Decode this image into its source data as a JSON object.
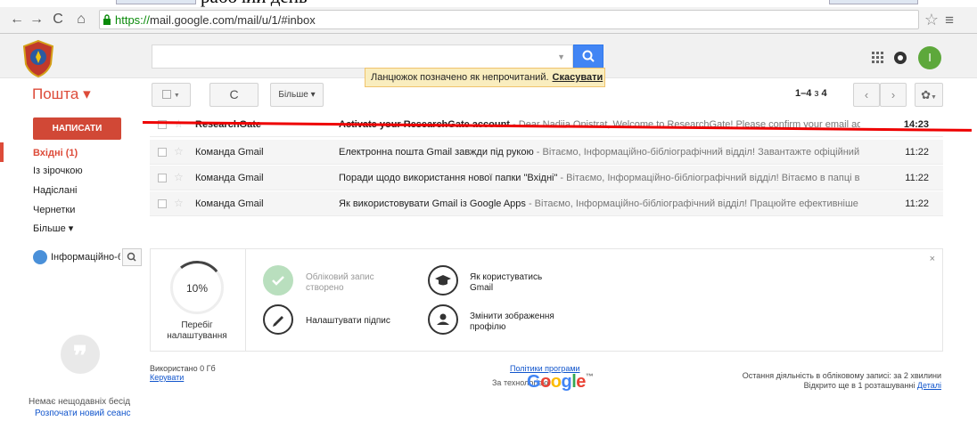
{
  "browser": {
    "cutoff_text": "рабочий день",
    "url_https": "https://",
    "url_rest": "mail.google.com/mail/u/1/#inbox"
  },
  "header": {
    "avatar_letter": "І"
  },
  "notice": {
    "text": "Ланцюжок позначено як непрочитаний.",
    "undo": "Скасувати"
  },
  "toolbar": {
    "mail_label": "Пошта ▾",
    "more_label": "Більше ▾",
    "pagination_range": "1–4",
    "pagination_of": " з ",
    "pagination_total": "4"
  },
  "sidebar": {
    "compose": "НАПИСАТИ",
    "items": [
      {
        "label": "Вхідні (1)"
      },
      {
        "label": "Із зірочкою"
      },
      {
        "label": "Надіслані"
      },
      {
        "label": "Чернетки"
      },
      {
        "label": "Більше ▾"
      }
    ],
    "hangout_name": "Інформаційно-б",
    "no_chats": "Немає нещодавніх бесід",
    "new_chat": "Розпочати новий сеанс"
  },
  "messages": [
    {
      "sender": "ResearchGate",
      "title": "Activate your ResearchGate account",
      "snippet": " - Dear Nadiia Onistrat, Welcome to ResearchGate! Please confirm your email address to acti",
      "time": "14:23",
      "unread": true
    },
    {
      "sender": "Команда Gmail",
      "title": "Електронна пошта Gmail завжди під рукою",
      "snippet": " - Вітаємо, Інформаційно-бібліографічний відділ! Завантажте офіційний додаток Gn",
      "time": "11:22",
      "unread": false
    },
    {
      "sender": "Команда Gmail",
      "title": "Поради щодо використання нової папки \"Вхідні\"",
      "snippet": " - Вітаємо, Інформаційно-бібліографічний відділ! Вітаємо в папці вхідних повід",
      "time": "11:22",
      "unread": false
    },
    {
      "sender": "Команда Gmail",
      "title": "Як використовувати Gmail із Google Apps",
      "snippet": " - Вітаємо, Інформаційно-бібліографічний відділ! Працюйте ефективніше з Gmail і Gc",
      "time": "11:22",
      "unread": false
    }
  ],
  "setup": {
    "progress_value": 0.1,
    "progress_text": "10%",
    "progress_caption": "Перебіг налаштування",
    "account_created": "Обліковий запис створено",
    "how_to_use": "Як користуватись Gmail",
    "set_signature": "Налаштувати підпис",
    "change_picture": "Змінити зображення профілю",
    "close": "×"
  },
  "footer": {
    "storage": "Використано 0 Гб",
    "manage": "Керувати",
    "policies": "Політики програми",
    "powered_by": "За технологією",
    "last_activity": "Остання діяльність в обліковому записі: за 2 хвилини",
    "open_in": "Відкрито ще в 1 розташуванні",
    "details": "Деталі"
  },
  "colors": {
    "compose": "#d14836",
    "accent": "#dd4b39",
    "search": "#4285f4",
    "notice_bg": "#f9edbe",
    "annotation": "#ee0000"
  }
}
